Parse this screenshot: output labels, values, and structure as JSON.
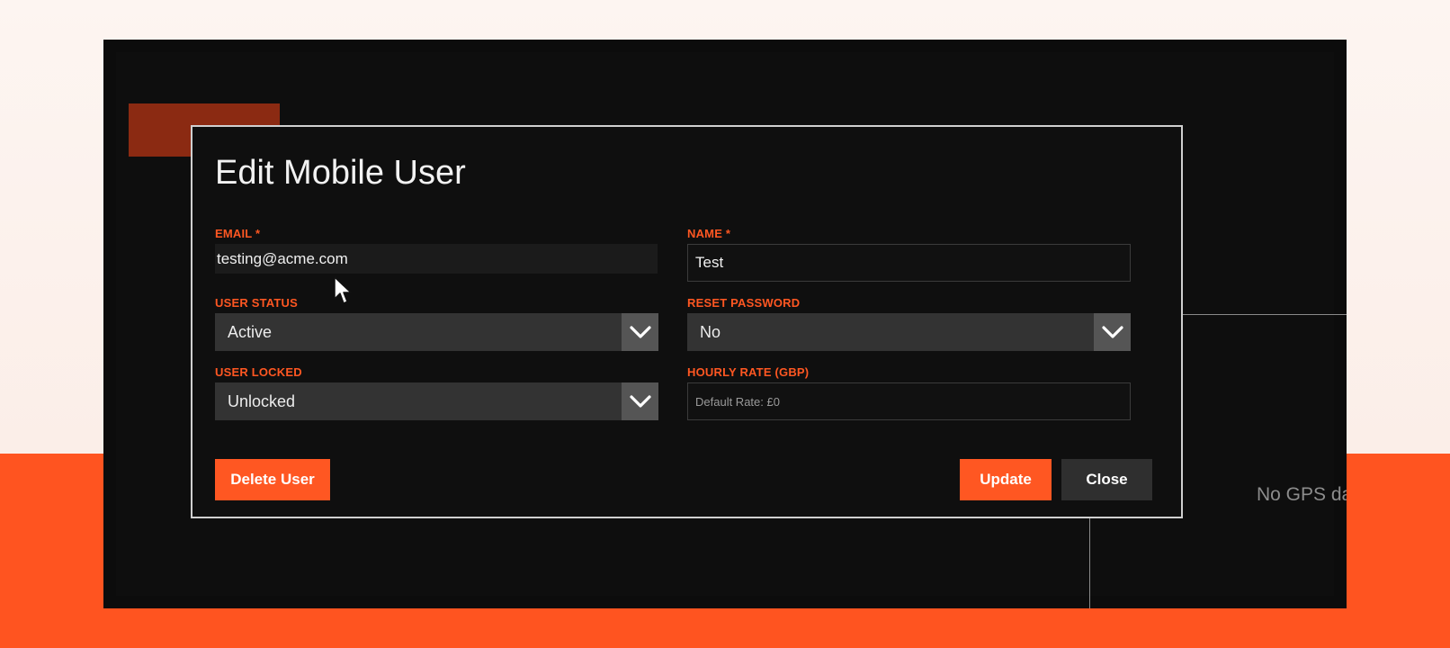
{
  "modal": {
    "title": "Edit Mobile User",
    "email": {
      "label": "EMAIL *",
      "value": "testing@acme.com"
    },
    "name": {
      "label": "NAME *",
      "value": "Test"
    },
    "user_status": {
      "label": "USER STATUS",
      "value": "Active"
    },
    "reset_password": {
      "label": "RESET PASSWORD",
      "value": "No"
    },
    "user_locked": {
      "label": "USER LOCKED",
      "value": "Unlocked"
    },
    "hourly_rate": {
      "label": "HOURLY RATE (GBP)",
      "placeholder": "Default Rate: £0"
    },
    "buttons": {
      "delete": "Delete User",
      "update": "Update",
      "close": "Close"
    }
  },
  "background": {
    "gps_status": "No GPS da"
  },
  "colors": {
    "accent": "#ff5722",
    "modal_bg": "#0f0f0f",
    "select_bg": "#333333"
  },
  "icons": {
    "select_chevron": "chevron-down-icon",
    "pointer": "mouse-cursor-icon"
  }
}
